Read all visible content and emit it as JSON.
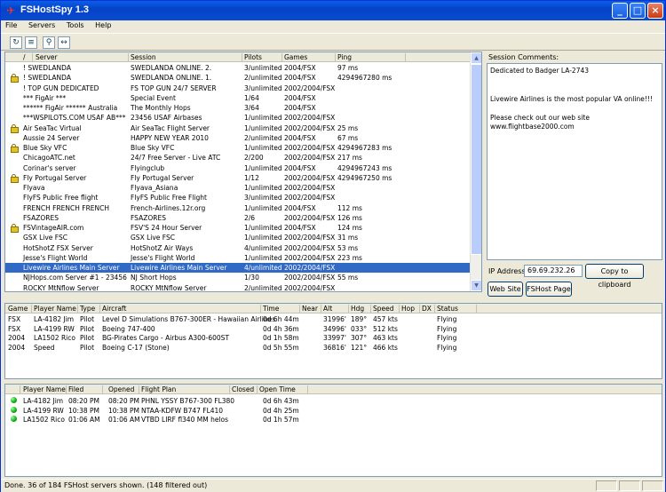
{
  "title": "FSHostSpy 1.3",
  "menu": [
    "File",
    "Servers",
    "Tools",
    "Help"
  ],
  "toolbar_icons": [
    "refresh-icon",
    "filter-icon",
    "search-icon",
    "connect-icon"
  ],
  "servers": {
    "columns": [
      "/",
      "Server",
      "Session",
      "Pilots",
      "Games",
      "Ping"
    ],
    "rows": [
      {
        "lock": false,
        "server": "!              SWEDLANDA",
        "session": "SWEDLANDA ONLINE. 2.",
        "pilots": "3/unlimited",
        "games": "2004/FSX",
        "ping": "97 ms"
      },
      {
        "lock": true,
        "server": "!              SWEDLANDA",
        "session": "SWEDLANDA ONLINE. 1.",
        "pilots": "2/unlimited",
        "games": "2004/FSX",
        "ping": "4294967280 ms"
      },
      {
        "lock": false,
        "server": "!       TOP GUN  DEDICATED",
        "session": "FS TOP GUN 24/7 SERVER",
        "pilots": "3/unlimited",
        "games": "2002/2004/FSX",
        "ping": ""
      },
      {
        "lock": false,
        "server": "*** FigAir ***",
        "session": "Special Event",
        "pilots": "1/64",
        "games": "2004/FSX",
        "ping": ""
      },
      {
        "lock": false,
        "server": "****** FigAir ****** Australia",
        "session": "The Monthly Hops",
        "pilots": "3/64",
        "games": "2004/FSX",
        "ping": ""
      },
      {
        "lock": false,
        "server": "***WSPILOTS.COM USAF AB***",
        "session": "23456 USAF Airbases",
        "pilots": "1/unlimited",
        "games": "2002/2004/FSX",
        "ping": ""
      },
      {
        "lock": true,
        "server": "Air SeaTac Virtual",
        "session": "Air SeaTac Flight Server",
        "pilots": "1/unlimited",
        "games": "2002/2004/FSX",
        "ping": "25 ms"
      },
      {
        "lock": false,
        "server": "Aussie 24  Server",
        "session": "HAPPY NEW YEAR 2010",
        "pilots": "2/unlimited",
        "games": "2004/FSX",
        "ping": "67 ms"
      },
      {
        "lock": true,
        "server": "Blue Sky VFC",
        "session": "Blue Sky VFC",
        "pilots": "1/unlimited",
        "games": "2002/2004/FSX",
        "ping": "4294967283 ms"
      },
      {
        "lock": false,
        "server": "ChicagoATC.net",
        "session": "24/7 Free Server - Live  ATC",
        "pilots": "2/200",
        "games": "2002/2004/FSX",
        "ping": "217 ms"
      },
      {
        "lock": false,
        "server": "Corinar's server",
        "session": "Flyingclub",
        "pilots": "1/unlimited",
        "games": "2004/FSX",
        "ping": "4294967243 ms"
      },
      {
        "lock": true,
        "server": "Fly Portugal Server",
        "session": "Fly Portugal Server",
        "pilots": "1/12",
        "games": "2002/2004/FSX",
        "ping": "4294967250 ms"
      },
      {
        "lock": false,
        "server": "Flyava",
        "session": "Flyava_Asiana",
        "pilots": "1/unlimited",
        "games": "2002/2004/FSX",
        "ping": ""
      },
      {
        "lock": false,
        "server": "FlyFS Public Free flight",
        "session": "FlyFS Public Free Flight",
        "pilots": "3/unlimited",
        "games": "2002/2004/FSX",
        "ping": ""
      },
      {
        "lock": false,
        "server": "FRENCH FRENCH FRENCH",
        "session": "French-Airlines.12r.org",
        "pilots": "1/unlimited",
        "games": "2004/FSX",
        "ping": "112 ms"
      },
      {
        "lock": false,
        "server": "FSAZORES",
        "session": "FSAZORES",
        "pilots": "2/6",
        "games": "2002/2004/FSX",
        "ping": "126 ms"
      },
      {
        "lock": true,
        "server": "FSVintageAIR.com",
        "session": "FSV'S 24 Hour Server",
        "pilots": "1/unlimited",
        "games": "2004/FSX",
        "ping": "124 ms"
      },
      {
        "lock": false,
        "server": "GSX Live FSC",
        "session": "GSX Live FSC",
        "pilots": "1/unlimited",
        "games": "2002/2004/FSX",
        "ping": "31 ms"
      },
      {
        "lock": false,
        "server": "HotShotZ FSX Server",
        "session": "HotShotZ Air Ways",
        "pilots": "4/unlimited",
        "games": "2002/2004/FSX",
        "ping": "53 ms"
      },
      {
        "lock": false,
        "server": "Jesse's Flight World",
        "session": "Jesse's Flight World",
        "pilots": "1/unlimited",
        "games": "2002/2004/FSX",
        "ping": "223 ms"
      },
      {
        "lock": false,
        "server": "Livewire Airlines Main Server",
        "session": "Livewire Airlines Main Server",
        "pilots": "4/unlimited",
        "games": "2002/2004/FSX",
        "ping": "",
        "selected": true
      },
      {
        "lock": false,
        "server": "NJHops.com Server #1 - 23456",
        "session": "NJ Short Hops",
        "pilots": "1/30",
        "games": "2002/2004/FSX",
        "ping": "55 ms"
      },
      {
        "lock": false,
        "server": "ROCKY MtNflow Server",
        "session": "ROCKY MtNflow Server",
        "pilots": "2/unlimited",
        "games": "2002/2004/FSX",
        "ping": ""
      }
    ]
  },
  "comments": {
    "label": "Session Comments:",
    "lines": [
      "Dedicated to Badger LA-2743",
      "",
      "",
      "Livewire Airlines is the most popular VA online!!!",
      "",
      "Please check out our web site",
      "www.flightbase2000.com"
    ],
    "ip_label": "IP Address:",
    "ip_value": "69.69.232.26",
    "copy_button": "Copy to clipboard",
    "web_site_button": "Web Site",
    "fshost_page_button": "FSHost Page"
  },
  "pilots": {
    "columns": [
      "Game",
      "Player Name",
      "Type",
      "Aircraft",
      "Time",
      "Near",
      "Alt",
      "Hdg",
      "Speed",
      "Hop",
      "DX",
      "Status"
    ],
    "rows": [
      {
        "game": "FSX",
        "player": "LA-4182 Jim",
        "type": "Pilot",
        "aircraft": "Level D Simulations B767-300ER - Hawaiian Airlines",
        "time": "0d 6h 44m",
        "near": "",
        "alt": "31996'",
        "hdg": "189°",
        "speed": "457 kts",
        "hop": "",
        "dx": "",
        "status": "Flying"
      },
      {
        "game": "FSX",
        "player": "LA-4199 RW",
        "type": "Pilot",
        "aircraft": "Boeing 747-400",
        "time": "0d 4h 36m",
        "near": "",
        "alt": "34996'",
        "hdg": "033°",
        "speed": "512 kts",
        "hop": "",
        "dx": "",
        "status": "Flying"
      },
      {
        "game": "2004",
        "player": "LA1502 Rico",
        "type": "Pilot",
        "aircraft": "BG-Pirates Cargo - Airbus A300-600ST",
        "time": "0d 1h 58m",
        "near": "",
        "alt": "33997'",
        "hdg": "307°",
        "speed": "463 kts",
        "hop": "",
        "dx": "",
        "status": "Flying"
      },
      {
        "game": "2004",
        "player": "Speed",
        "type": "Pilot",
        "aircraft": "Boeing C-17 (Stone)",
        "time": "0d 5h 55m",
        "near": "",
        "alt": "36816'",
        "hdg": "121°",
        "speed": "466 kts",
        "hop": "",
        "dx": "",
        "status": "Flying"
      }
    ]
  },
  "flightplans": {
    "columns": [
      "",
      "Player Name",
      "Filed",
      "Opened",
      "Flight Plan",
      "Closed",
      "Open Time"
    ],
    "rows": [
      {
        "player": "LA-4182 Jim",
        "filed": "08:20 PM",
        "opened": "08:20 PM",
        "plan": "PHNL YSSY B767-300 FL380",
        "closed": "",
        "open_time": "0d 6h 43m"
      },
      {
        "player": "LA-4199 RW",
        "filed": "10:38 PM",
        "opened": "10:38 PM",
        "plan": "NTAA-KDFW B747 FL410",
        "closed": "",
        "open_time": "0d 4h 25m"
      },
      {
        "player": "LA1502 Rico",
        "filed": "01:06 AM",
        "opened": "01:06 AM",
        "plan": "VTBD LIRF fl340 MM helos",
        "closed": "",
        "open_time": "0d 1h 57m"
      }
    ]
  },
  "status": "Done. 36 of 184 FSHost servers shown. (148 filtered out)"
}
